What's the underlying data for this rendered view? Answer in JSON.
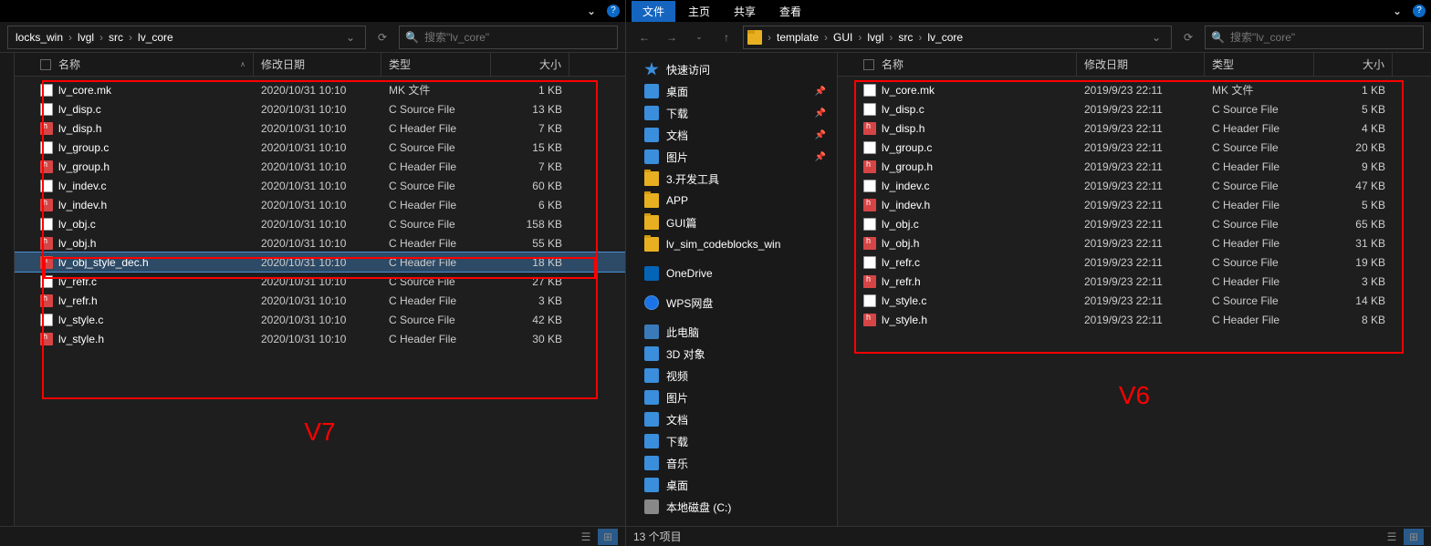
{
  "left": {
    "top": {
      "min": "v",
      "help": "?"
    },
    "crumbs": [
      "locks_win",
      "lvgl",
      "src",
      "lv_core"
    ],
    "search_ph": "搜索\"lv_core\"",
    "cols": {
      "name": "名称",
      "date": "修改日期",
      "type": "类型",
      "size": "大小"
    },
    "files": [
      {
        "n": "lv_core.mk",
        "d": "2020/10/31 10:10",
        "t": "MK 文件",
        "s": "1 KB",
        "i": "mk"
      },
      {
        "n": "lv_disp.c",
        "d": "2020/10/31 10:10",
        "t": "C Source File",
        "s": "13 KB",
        "i": "c"
      },
      {
        "n": "lv_disp.h",
        "d": "2020/10/31 10:10",
        "t": "C Header File",
        "s": "7 KB",
        "i": "h"
      },
      {
        "n": "lv_group.c",
        "d": "2020/10/31 10:10",
        "t": "C Source File",
        "s": "15 KB",
        "i": "c"
      },
      {
        "n": "lv_group.h",
        "d": "2020/10/31 10:10",
        "t": "C Header File",
        "s": "7 KB",
        "i": "h"
      },
      {
        "n": "lv_indev.c",
        "d": "2020/10/31 10:10",
        "t": "C Source File",
        "s": "60 KB",
        "i": "c"
      },
      {
        "n": "lv_indev.h",
        "d": "2020/10/31 10:10",
        "t": "C Header File",
        "s": "6 KB",
        "i": "h"
      },
      {
        "n": "lv_obj.c",
        "d": "2020/10/31 10:10",
        "t": "C Source File",
        "s": "158 KB",
        "i": "c"
      },
      {
        "n": "lv_obj.h",
        "d": "2020/10/31 10:10",
        "t": "C Header File",
        "s": "55 KB",
        "i": "h"
      },
      {
        "n": "lv_obj_style_dec.h",
        "d": "2020/10/31 10:10",
        "t": "C Header File",
        "s": "18 KB",
        "i": "h",
        "sel": true
      },
      {
        "n": "lv_refr.c",
        "d": "2020/10/31 10:10",
        "t": "C Source File",
        "s": "27 KB",
        "i": "c"
      },
      {
        "n": "lv_refr.h",
        "d": "2020/10/31 10:10",
        "t": "C Header File",
        "s": "3 KB",
        "i": "h"
      },
      {
        "n": "lv_style.c",
        "d": "2020/10/31 10:10",
        "t": "C Source File",
        "s": "42 KB",
        "i": "c"
      },
      {
        "n": "lv_style.h",
        "d": "2020/10/31 10:10",
        "t": "C Header File",
        "s": "30 KB",
        "i": "h"
      }
    ],
    "label": "V7"
  },
  "right": {
    "tabs": [
      "文件",
      "主页",
      "共享",
      "查看"
    ],
    "crumbs": [
      "template",
      "GUI",
      "lvgl",
      "src",
      "lv_core"
    ],
    "search_ph": "搜索\"lv_core\"",
    "cols": {
      "name": "名称",
      "date": "修改日期",
      "type": "类型",
      "size": "大小"
    },
    "side": [
      {
        "l": "快速访问",
        "i": "star"
      },
      {
        "l": "桌面",
        "i": "desk",
        "pin": true
      },
      {
        "l": "下载",
        "i": "dl",
        "pin": true
      },
      {
        "l": "文档",
        "i": "doc",
        "pin": true
      },
      {
        "l": "图片",
        "i": "pic",
        "pin": true
      },
      {
        "l": "3.开发工具",
        "i": "folder"
      },
      {
        "l": "APP",
        "i": "folder"
      },
      {
        "l": "GUI篇",
        "i": "folder"
      },
      {
        "l": "lv_sim_codeblocks_win",
        "i": "folder"
      },
      {
        "gap": true
      },
      {
        "l": "OneDrive",
        "i": "od"
      },
      {
        "gap": true
      },
      {
        "l": "WPS网盘",
        "i": "wps"
      },
      {
        "gap": true
      },
      {
        "l": "此电脑",
        "i": "pc"
      },
      {
        "l": "3D 对象",
        "i": "3d"
      },
      {
        "l": "视频",
        "i": "vid"
      },
      {
        "l": "图片",
        "i": "pic"
      },
      {
        "l": "文档",
        "i": "doc"
      },
      {
        "l": "下载",
        "i": "dl"
      },
      {
        "l": "音乐",
        "i": "mus"
      },
      {
        "l": "桌面",
        "i": "desk"
      },
      {
        "l": "本地磁盘 (C:)",
        "i": "disk"
      }
    ],
    "files": [
      {
        "n": "lv_core.mk",
        "d": "2019/9/23 22:11",
        "t": "MK 文件",
        "s": "1 KB",
        "i": "mk"
      },
      {
        "n": "lv_disp.c",
        "d": "2019/9/23 22:11",
        "t": "C Source File",
        "s": "5 KB",
        "i": "c"
      },
      {
        "n": "lv_disp.h",
        "d": "2019/9/23 22:11",
        "t": "C Header File",
        "s": "4 KB",
        "i": "h"
      },
      {
        "n": "lv_group.c",
        "d": "2019/9/23 22:11",
        "t": "C Source File",
        "s": "20 KB",
        "i": "c"
      },
      {
        "n": "lv_group.h",
        "d": "2019/9/23 22:11",
        "t": "C Header File",
        "s": "9 KB",
        "i": "h"
      },
      {
        "n": "lv_indev.c",
        "d": "2019/9/23 22:11",
        "t": "C Source File",
        "s": "47 KB",
        "i": "c"
      },
      {
        "n": "lv_indev.h",
        "d": "2019/9/23 22:11",
        "t": "C Header File",
        "s": "5 KB",
        "i": "h"
      },
      {
        "n": "lv_obj.c",
        "d": "2019/9/23 22:11",
        "t": "C Source File",
        "s": "65 KB",
        "i": "c"
      },
      {
        "n": "lv_obj.h",
        "d": "2019/9/23 22:11",
        "t": "C Header File",
        "s": "31 KB",
        "i": "h"
      },
      {
        "n": "lv_refr.c",
        "d": "2019/9/23 22:11",
        "t": "C Source File",
        "s": "19 KB",
        "i": "c"
      },
      {
        "n": "lv_refr.h",
        "d": "2019/9/23 22:11",
        "t": "C Header File",
        "s": "3 KB",
        "i": "h"
      },
      {
        "n": "lv_style.c",
        "d": "2019/9/23 22:11",
        "t": "C Source File",
        "s": "14 KB",
        "i": "c"
      },
      {
        "n": "lv_style.h",
        "d": "2019/9/23 22:11",
        "t": "C Header File",
        "s": "8 KB",
        "i": "h"
      }
    ],
    "status": "13 个项目",
    "label": "V6"
  }
}
